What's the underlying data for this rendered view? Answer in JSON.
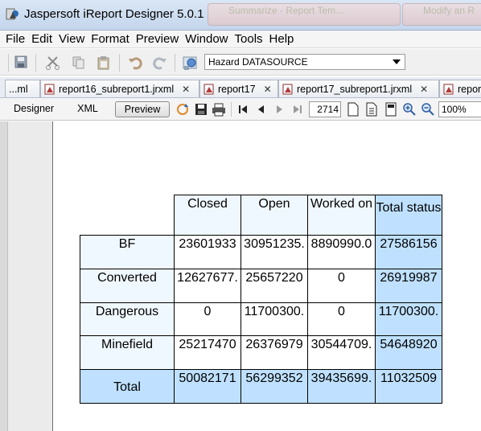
{
  "window": {
    "title": "Jaspersoft iReport Designer 5.0.1",
    "background_tabs": [
      "Summarize - Report Tem...",
      "Modify an R"
    ]
  },
  "menu": [
    "File",
    "Edit",
    "View",
    "Format",
    "Preview",
    "Window",
    "Tools",
    "Help"
  ],
  "toolbar": {
    "datasource": "Hazard DATASOURCE"
  },
  "doc_tabs": [
    {
      "label": "...ml",
      "closable": false
    },
    {
      "label": "report16_subreport1.jrxml",
      "closable": true
    },
    {
      "label": "report17",
      "closable": true
    },
    {
      "label": "report17_subreport1.jrxml",
      "closable": true
    },
    {
      "label": "repor",
      "closable": false
    }
  ],
  "view": {
    "designer_label": "Designer",
    "xml_label": "XML",
    "preview_label": "Preview",
    "page_number": "2714",
    "zoom": "100%"
  },
  "crosstab": {
    "column_headers": [
      "Closed",
      "Open",
      "Worked on"
    ],
    "total_header": "Total status",
    "rows": [
      {
        "label": "BF",
        "values": [
          "23601933",
          "30951235.",
          "8890990.0"
        ],
        "total": "27586156"
      },
      {
        "label": "Converted",
        "values": [
          "12627677.",
          "25657220",
          "0"
        ],
        "total": "26919987"
      },
      {
        "label": "Dangerous",
        "values": [
          "0",
          "11700300.",
          "0"
        ],
        "total": "11700300."
      },
      {
        "label": "Minefield",
        "values": [
          "25217470",
          "26376979",
          "30544709."
        ],
        "total": "54648920"
      }
    ],
    "total_row": {
      "label": "Total",
      "values": [
        "50082171",
        "56299352",
        "39435699."
      ],
      "total": "11032509"
    }
  },
  "colors": {
    "header_bg": "#f0f8ff",
    "total_bg": "#bfe1ff"
  }
}
